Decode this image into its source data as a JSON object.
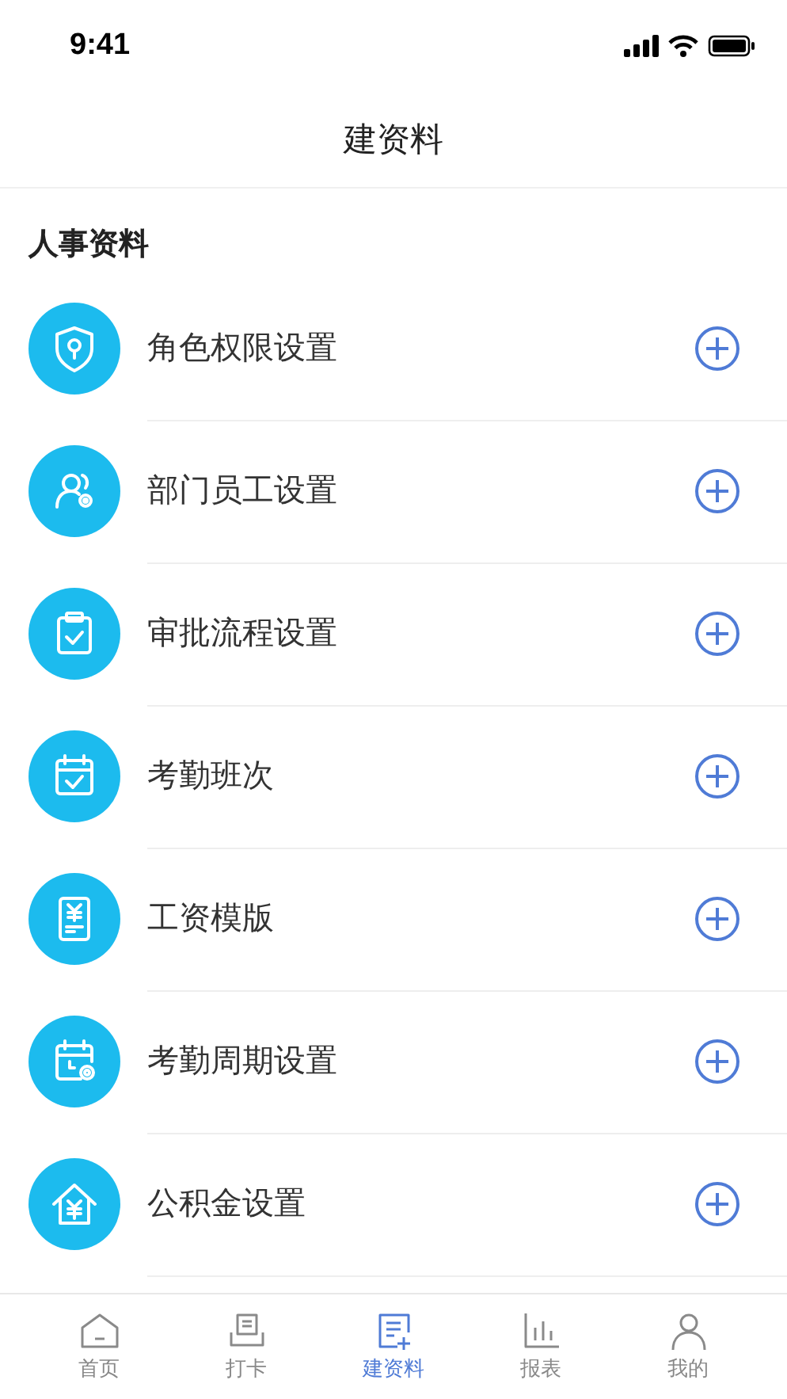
{
  "status_bar": {
    "time": "9:41"
  },
  "header": {
    "title": "建资料"
  },
  "section": {
    "title": "人事资料"
  },
  "items": [
    {
      "label": "角色权限设置"
    },
    {
      "label": "部门员工设置"
    },
    {
      "label": "审批流程设置"
    },
    {
      "label": "考勤班次"
    },
    {
      "label": "工资模版"
    },
    {
      "label": "考勤周期设置"
    },
    {
      "label": "公积金设置"
    }
  ],
  "tab_bar": [
    {
      "label": "首页",
      "selected": false
    },
    {
      "label": "打卡",
      "selected": false
    },
    {
      "label": "建资料",
      "selected": true
    },
    {
      "label": "报表",
      "selected": false
    },
    {
      "label": "我的",
      "selected": false
    }
  ]
}
